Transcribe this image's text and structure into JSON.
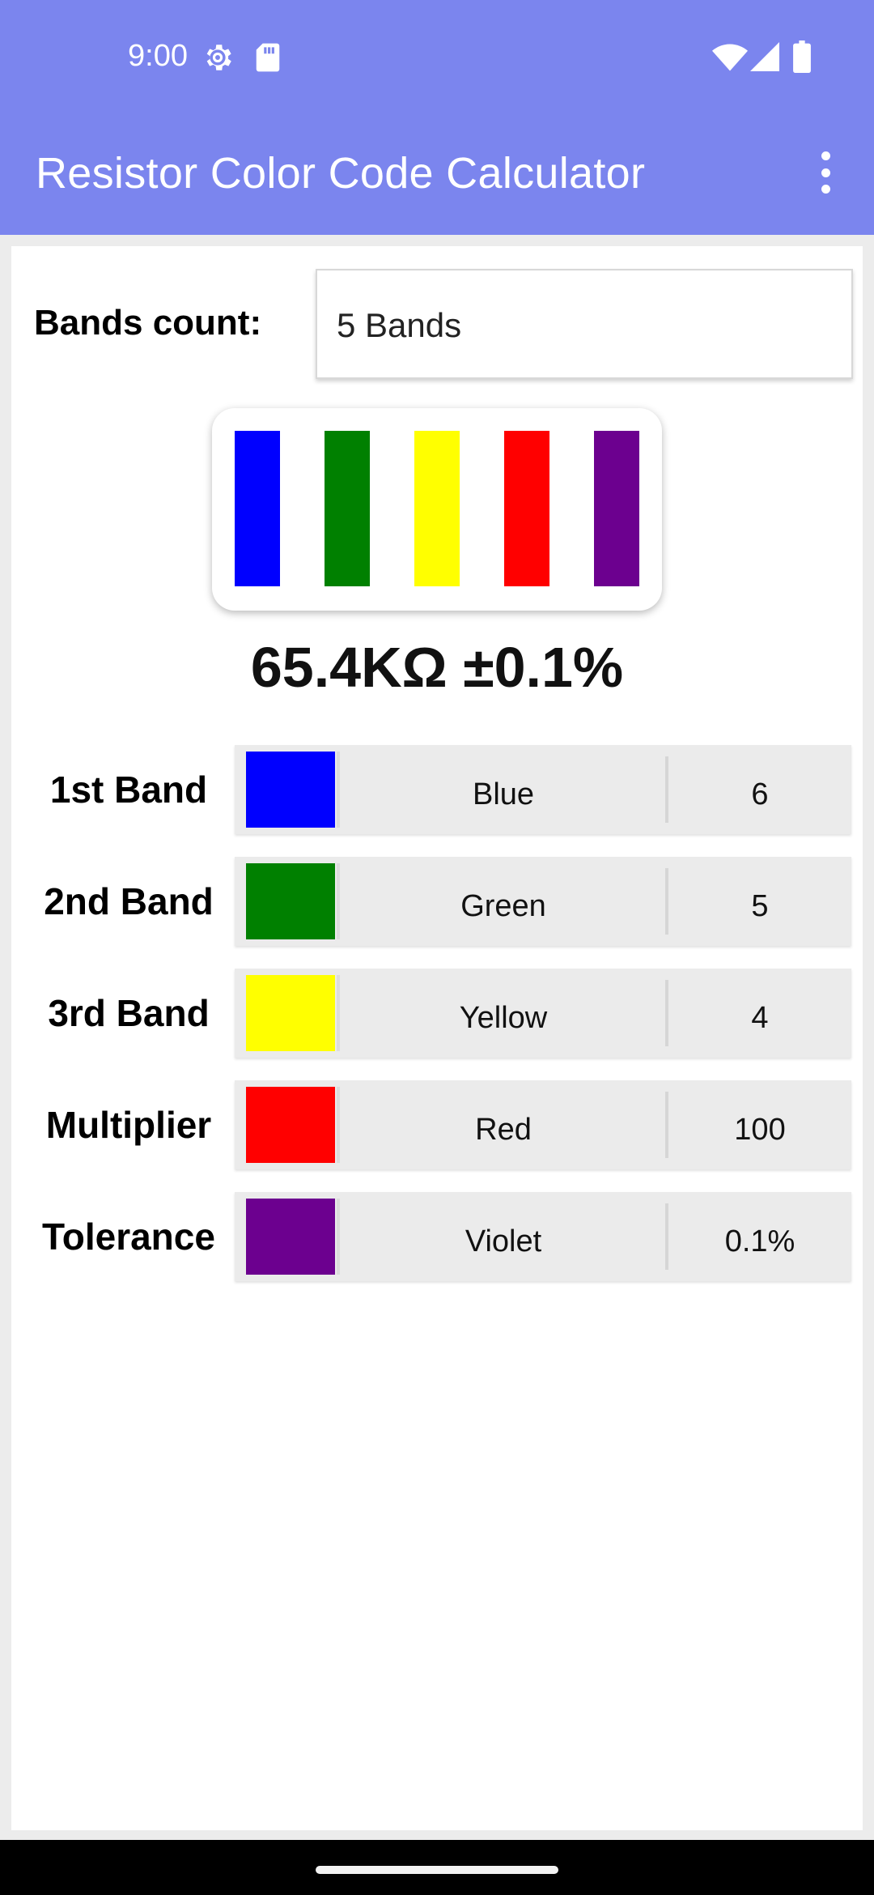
{
  "status_bar": {
    "time": "9:00",
    "icons": [
      "gear-icon",
      "sd-card-icon",
      "wifi-icon",
      "signal-icon",
      "battery-icon"
    ]
  },
  "app_bar": {
    "title": "Resistor Color Code Calculator",
    "menu_icon": "more-vert-icon"
  },
  "bands_count": {
    "label": "Bands count:",
    "selected": "5 Bands"
  },
  "resistor": {
    "stripes": [
      "#0000ff",
      "#008000",
      "#ffff00",
      "#ff0000",
      "#6c008f"
    ]
  },
  "result": "65.4KΩ ±0.1%",
  "bands": [
    {
      "label": "1st Band",
      "color_name": "Blue",
      "color": "#0000ff",
      "value": "6"
    },
    {
      "label": "2nd Band",
      "color_name": "Green",
      "color": "#008000",
      "value": "5"
    },
    {
      "label": "3rd Band",
      "color_name": "Yellow",
      "color": "#ffff00",
      "value": "4"
    },
    {
      "label": "Multiplier",
      "color_name": "Red",
      "color": "#ff0000",
      "value": "100"
    },
    {
      "label": "Tolerance",
      "color_name": "Violet",
      "color": "#6c008f",
      "value": "0.1%"
    }
  ],
  "colors": {
    "accent": "#7b85ee"
  }
}
